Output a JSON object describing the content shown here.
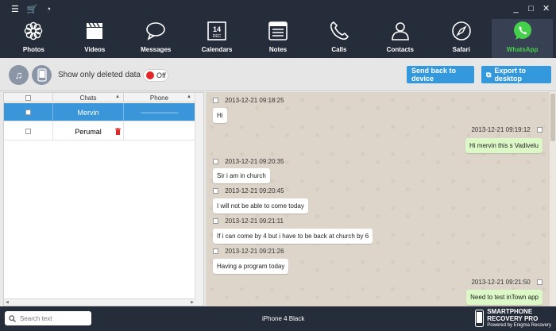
{
  "nav": {
    "items": [
      {
        "label": "Photos",
        "icon": "flower-icon"
      },
      {
        "label": "Videos",
        "icon": "clapper-icon"
      },
      {
        "label": "Messages",
        "icon": "speech-bubble-icon"
      },
      {
        "label": "Calendars",
        "icon": "calendar-icon"
      },
      {
        "label": "Notes",
        "icon": "notes-icon"
      },
      {
        "label": "Calls",
        "icon": "phone-icon"
      },
      {
        "label": "Contacts",
        "icon": "person-icon"
      },
      {
        "label": "Safari",
        "icon": "compass-icon"
      },
      {
        "label": "WhatsApp",
        "icon": "whatsapp-icon"
      }
    ],
    "active": "WhatsApp",
    "calendar_day": "14",
    "calendar_month": "DEC"
  },
  "toolbar": {
    "show_deleted_label": "Show only deleted data",
    "toggle_state": "Off",
    "send_back_label": "Send back to device",
    "export_label": "Export to desktop"
  },
  "chat_list": {
    "columns": [
      "Chats",
      "Phone"
    ],
    "rows": [
      {
        "name": "Mervin",
        "phone": "~~~~~~~~~~~",
        "selected": true
      },
      {
        "name": "Perumal",
        "phone": "",
        "selected": false
      }
    ]
  },
  "conversation": {
    "messages": [
      {
        "ts": "2013-12-21 09:18:25",
        "text": "Hi",
        "dir": "in"
      },
      {
        "ts": "2013-12-21 09:19:12",
        "text": "Hi mervin this s Vadivelu",
        "dir": "out"
      },
      {
        "ts": "2013-12-21 09:20:35",
        "text": "Sir i am in church",
        "dir": "in"
      },
      {
        "ts": "2013-12-21 09:20:45",
        "text": "I will not be able to come today",
        "dir": "in"
      },
      {
        "ts": "2013-12-21 09:21:11",
        "text": "If i can come by 4 but i have to be back at church by 6",
        "dir": "in"
      },
      {
        "ts": "2013-12-21 09:21:26",
        "text": "Having a program today",
        "dir": "in"
      },
      {
        "ts": "2013-12-21 09:21:50",
        "text": "Need to test inTown app",
        "dir": "out"
      }
    ]
  },
  "bottom": {
    "search_placeholder": "Search text",
    "device": "iPhone 4 Black",
    "brand_line1": "SMARTPHONE",
    "brand_line2": "RECOVERY PRO",
    "brand_line3": "Powered by Enigma Recovery"
  },
  "colors": {
    "topbar": "#262d3a",
    "accent_blue": "#3498dc",
    "whatsapp_green": "#45d04b",
    "bubble_out": "#dcf8c6"
  }
}
